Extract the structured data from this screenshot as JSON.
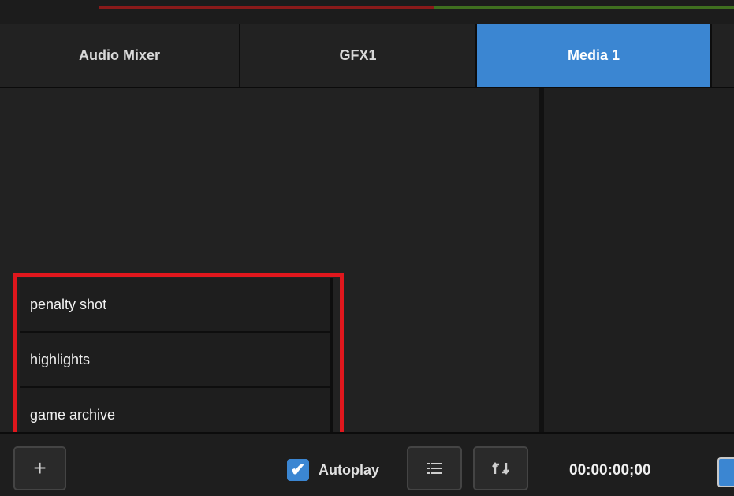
{
  "tabs": [
    {
      "label": "Audio Mixer"
    },
    {
      "label": "GFX1"
    },
    {
      "label": "Media 1"
    }
  ],
  "active_tab": "Media 1",
  "media_list": {
    "items": [
      {
        "label": "penalty shot"
      },
      {
        "label": "highlights"
      },
      {
        "label": "game archive"
      }
    ]
  },
  "toolbar": {
    "add_symbol": "+",
    "autoplay_label": "Autoplay",
    "autoplay_checked": true,
    "checkmark": "✔",
    "list_icon": "list-icon",
    "loop_icon": "loop-icon",
    "timecode": "00:00:00;00"
  },
  "colors": {
    "accent": "#3b86d2",
    "highlight": "#e0171d",
    "panel": "#222222"
  }
}
